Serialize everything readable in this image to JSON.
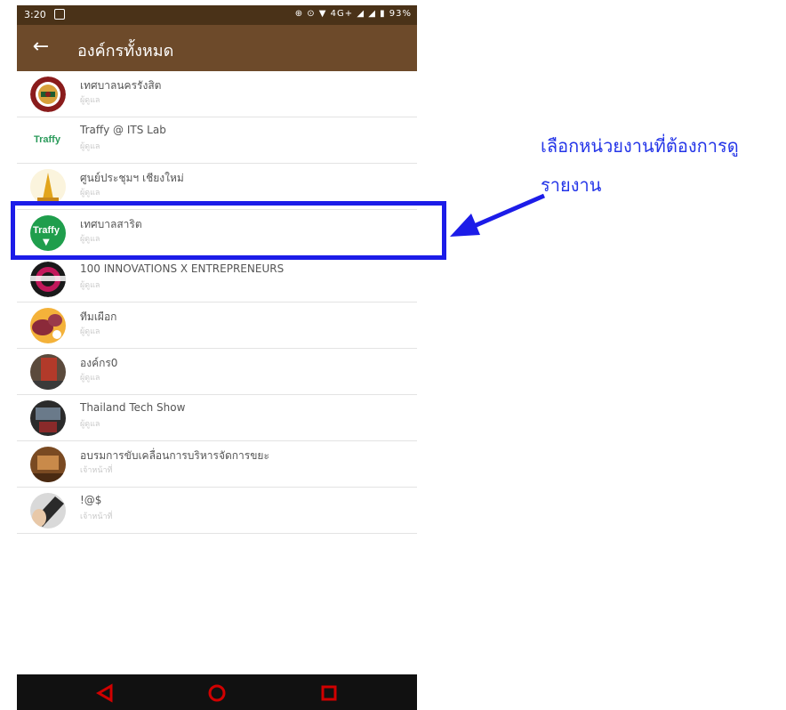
{
  "status_bar": {
    "time": "3:20",
    "indicators": "⊕ ⊙ ▼ 4G+ ◢ ◢ ▮ 93%"
  },
  "app_bar": {
    "back_icon": "←",
    "title": "องค์กรทั้งหมด"
  },
  "organizations": [
    {
      "name": "เทศบาลนครรังสิต",
      "role": "ผู้ดูแล",
      "avatar": "seal"
    },
    {
      "name": "Traffy @ ITS Lab",
      "role": "ผู้ดูแล",
      "avatar": "traffy-text",
      "logo_text": "Traffy"
    },
    {
      "name": "ศูนย์ประชุมฯ เชียงใหม่",
      "role": "ผู้ดูแล",
      "avatar": "pagoda"
    },
    {
      "name": "เทศบาลสาริต",
      "role": "ผู้ดูแล",
      "avatar": "traffy-green",
      "logo_text": "Traffy"
    },
    {
      "name": "100 INNOVATIONS X ENTREPRENEURS",
      "role": "ผู้ดูแล",
      "avatar": "innovations"
    },
    {
      "name": "ทีมเผือก",
      "role": "ผู้ดูแล",
      "avatar": "taro"
    },
    {
      "name": "องค์กร0",
      "role": "ผู้ดูแล",
      "avatar": "photo-red"
    },
    {
      "name": "Thailand Tech Show",
      "role": "ผู้ดูแล",
      "avatar": "photo-booth"
    },
    {
      "name": "อบรมการขับเคลื่อนการบริหารจัดการขยะ",
      "role": "เจ้าหน้าที่",
      "avatar": "photo-room"
    },
    {
      "name": "!@$",
      "role": "เจ้าหน้าที่",
      "avatar": "photo-hand"
    }
  ],
  "nav_bar": {
    "back": "back-triangle-icon",
    "home": "home-circle-icon",
    "recents": "recents-square-icon"
  },
  "annotation": {
    "line1": "เลือกหน่วยงานที่ต้องการดู",
    "line2": "รายงาน",
    "color": "#2435e8"
  },
  "colors": {
    "status_bar": "#4a3218",
    "app_bar": "#6d4a2a",
    "highlight_box": "#1c1ce8",
    "nav_icons": "#d10000"
  }
}
